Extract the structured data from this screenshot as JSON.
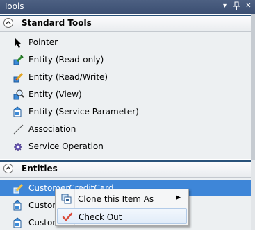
{
  "window": {
    "title": "Tools"
  },
  "standard_tools": {
    "header": "Standard Tools",
    "items": [
      {
        "label": "Pointer",
        "icon": "pointer-icon"
      },
      {
        "label": "Entity (Read-only)",
        "icon": "entity-readonly-icon"
      },
      {
        "label": "Entity (Read/Write)",
        "icon": "entity-readwrite-icon"
      },
      {
        "label": "Entity (View)",
        "icon": "entity-view-icon"
      },
      {
        "label": "Entity (Service Parameter)",
        "icon": "entity-service-parameter-icon"
      },
      {
        "label": "Association",
        "icon": "association-icon"
      },
      {
        "label": "Service Operation",
        "icon": "service-operation-icon"
      }
    ]
  },
  "entities": {
    "header": "Entities",
    "items": [
      {
        "label": "CustomerCreditCard",
        "selected": true
      },
      {
        "label": "Custom"
      },
      {
        "label": "CustomerCreditCardSelect"
      }
    ]
  },
  "context_menu": {
    "items": [
      {
        "label": "Clone this Item As",
        "icon": "clone-icon",
        "has_submenu": true
      },
      {
        "label": "Check Out",
        "icon": "checkmark-icon",
        "highlighted": true
      }
    ]
  },
  "colors": {
    "selection": "#3e86d8",
    "header_border": "#29527a",
    "panel_bg": "#edf0f2"
  }
}
